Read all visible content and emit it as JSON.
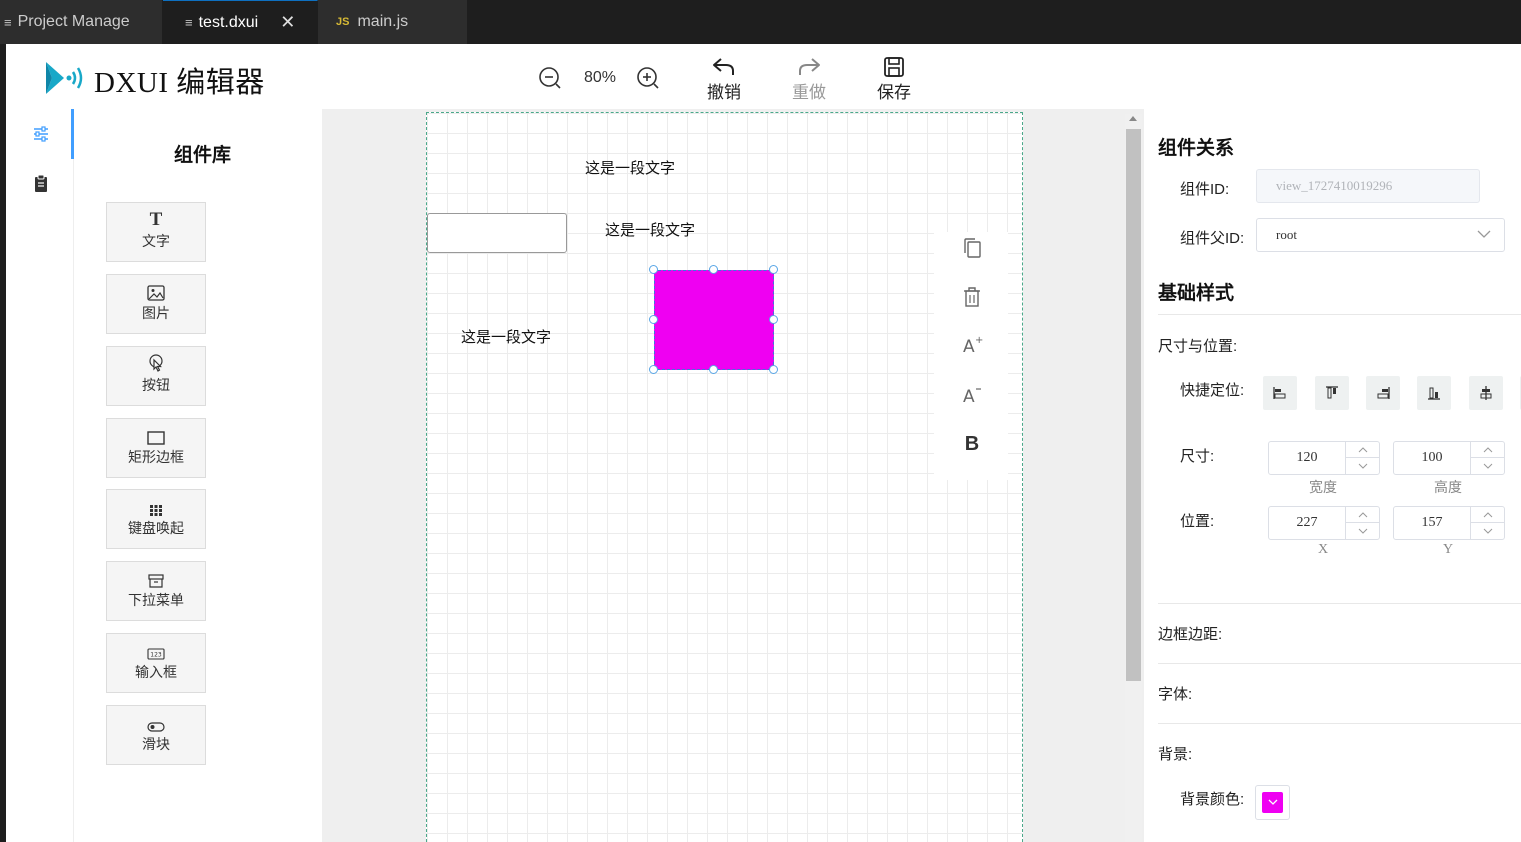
{
  "tabs": [
    {
      "icon": "≡",
      "label": "Project Manage"
    },
    {
      "icon": "≡",
      "label": "test.dxui",
      "close": "✕"
    },
    {
      "icon": "JS",
      "label": "main.js"
    }
  ],
  "header": {
    "title": "DXUI 编辑器",
    "zoom": "80%",
    "undo": "撤销",
    "redo": "重做",
    "save": "保存"
  },
  "library": {
    "title": "组件库",
    "items": [
      {
        "label": "文字",
        "icon": "text-icon"
      },
      {
        "label": "图片",
        "icon": "image-icon"
      },
      {
        "label": "按钮",
        "icon": "pointer-icon"
      },
      {
        "label": "矩形边框",
        "icon": "rectangle-icon"
      },
      {
        "label": "键盘唤起",
        "icon": "keypad-icon"
      },
      {
        "label": "下拉菜单",
        "icon": "dropdown-icon"
      },
      {
        "label": "输入框",
        "icon": "input-icon"
      },
      {
        "label": "滑块",
        "icon": "toggle-icon"
      }
    ]
  },
  "canvas": {
    "texts": [
      "这是一段文字",
      "这是一段文字",
      "这是一段文字"
    ],
    "rect_color": "#ef00f2",
    "float_tools": [
      "copy-icon",
      "trash-icon",
      "font-increase-icon",
      "font-decrease-icon",
      "bold-icon"
    ],
    "bold_label": "B"
  },
  "panel": {
    "relation_title": "组件关系",
    "id_label": "组件ID:",
    "id_value": "view_1727410019296",
    "parent_label": "组件父ID:",
    "parent_value": "root",
    "style_title": "基础样式",
    "size_pos_label": "尺寸与位置:",
    "quick_label": "快捷定位:",
    "size_label": "尺寸:",
    "width": "120",
    "height": "100",
    "width_label": "宽度",
    "height_label": "高度",
    "pos_label": "位置:",
    "x": "227",
    "y": "157",
    "x_label": "X",
    "y_label": "Y",
    "border_label": "边框边距:",
    "font_label": "字体:",
    "bg_label": "背景:",
    "bg_color_label": "背景颜色:",
    "bg_color": "#ef00f2"
  }
}
